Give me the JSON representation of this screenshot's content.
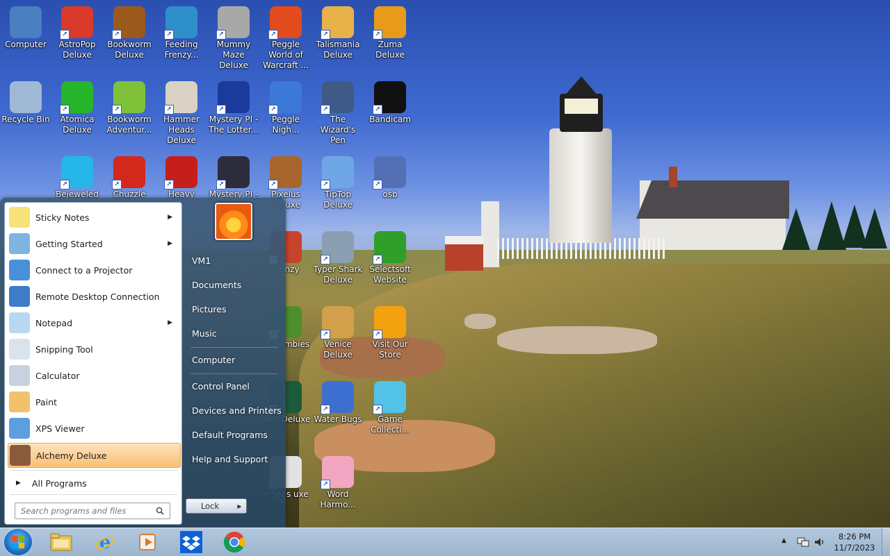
{
  "desktop": {
    "icons": [
      {
        "label": "Computer",
        "icon": "computer-icon",
        "color": "#4a7fc2"
      },
      {
        "label": "AstroPop Deluxe",
        "icon": "astropop-icon",
        "color": "#d93a2a"
      },
      {
        "label": "Bookworm Deluxe",
        "icon": "bookworm-icon",
        "color": "#9b5a1c"
      },
      {
        "label": "Feeding Frenzy...",
        "icon": "feeding-frenzy-icon",
        "color": "#2f8fc9"
      },
      {
        "label": "Mummy Maze Deluxe",
        "icon": "mummy-maze-icon",
        "color": "#a8a8a8"
      },
      {
        "label": "Peggle World of Warcraft ...",
        "icon": "peggle-wow-icon",
        "color": "#e24b1d"
      },
      {
        "label": "Talismania Deluxe",
        "icon": "talismania-icon",
        "color": "#e7b24a"
      },
      {
        "label": "Zuma Deluxe",
        "icon": "zuma-icon",
        "color": "#e89a1a"
      },
      {
        "label": "Recycle Bin",
        "icon": "recycle-bin-icon",
        "color": "#9fb8d4"
      },
      {
        "label": "Atomica Deluxe",
        "icon": "atomica-icon",
        "color": "#26b52a"
      },
      {
        "label": "Bookworm Adventur...",
        "icon": "bookworm-adventures-icon",
        "color": "#7fc23a"
      },
      {
        "label": "Hammer Heads Deluxe",
        "icon": "hammer-heads-icon",
        "color": "#d9d2c4"
      },
      {
        "label": "Mystery PI - The Lotter...",
        "icon": "mystery-pi-lottery-icon",
        "color": "#1a3a9c"
      },
      {
        "label": "Peggle Nigh...",
        "icon": "peggle-nights-icon",
        "color": "#3c78d8"
      },
      {
        "label": "The Wizard's Pen",
        "icon": "wizards-pen-icon",
        "color": "#3f5a87"
      },
      {
        "label": "Bandicam",
        "icon": "bandicam-icon",
        "color": "#111111"
      },
      {
        "label": "Bejeweled",
        "icon": "bejeweled-icon",
        "color": "#25b7e8"
      },
      {
        "label": "Chuzzle",
        "icon": "chuzzle-icon",
        "color": "#d3281c"
      },
      {
        "label": "Heavy",
        "icon": "heavy-weapon-icon",
        "color": "#c61d1d"
      },
      {
        "label": "Mystery PI -",
        "icon": "mystery-pi-icon",
        "color": "#2c2c3a"
      },
      {
        "label": "Pixelus Deluxe",
        "icon": "pixelus-icon",
        "color": "#a8662c"
      },
      {
        "label": "TipTop Deluxe",
        "icon": "tiptop-icon",
        "color": "#6fa7e6"
      },
      {
        "label": "osb",
        "icon": "osb-file-icon",
        "color": "#5470b5"
      },
      {
        "label": "Frenzy",
        "icon": "frenzy-icon",
        "color": "#c7432b"
      },
      {
        "label": "Typer Shark Deluxe",
        "icon": "typer-shark-icon",
        "color": "#8aa0b2"
      },
      {
        "label": "Selectsoft Website",
        "icon": "selectsoft-icon",
        "color": "#2f9f2a"
      },
      {
        "label": "ts vs mbies",
        "icon": "plants-vs-zombies-icon",
        "color": "#4e8f2a"
      },
      {
        "label": "Venice Deluxe",
        "icon": "venice-icon",
        "color": "#d2a04a"
      },
      {
        "label": "Visit Our Store",
        "icon": "visit-store-icon",
        "color": "#f2a10f"
      },
      {
        "label": "cket Deluxe",
        "icon": "rocket-icon",
        "color": "#1b5a3a"
      },
      {
        "label": "Water Bugs",
        "icon": "water-bugs-icon",
        "color": "#3d6fd1"
      },
      {
        "label": "Game Collecti...",
        "icon": "game-collection-icon",
        "color": "#52c3e6"
      },
      {
        "label": "n Seas uxe",
        "icon": "seas-icon",
        "color": "#e2e2e2"
      },
      {
        "label": "Word Harmo...",
        "icon": "word-harmony-icon",
        "color": "#f2a6c2"
      }
    ]
  },
  "start_menu": {
    "programs": [
      {
        "label": "Sticky Notes",
        "icon": "sticky-notes-icon",
        "submenu": true
      },
      {
        "label": "Getting Started",
        "icon": "getting-started-icon",
        "submenu": true
      },
      {
        "label": "Connect to a Projector",
        "icon": "projector-icon",
        "submenu": false
      },
      {
        "label": "Remote Desktop Connection",
        "icon": "remote-desktop-icon",
        "submenu": false
      },
      {
        "label": "Notepad",
        "icon": "notepad-icon",
        "submenu": true
      },
      {
        "label": "Snipping Tool",
        "icon": "snipping-tool-icon",
        "submenu": false
      },
      {
        "label": "Calculator",
        "icon": "calculator-icon",
        "submenu": false
      },
      {
        "label": "Paint",
        "icon": "paint-icon",
        "submenu": false
      },
      {
        "label": "XPS Viewer",
        "icon": "xps-viewer-icon",
        "submenu": false
      },
      {
        "label": "Alchemy Deluxe",
        "icon": "alchemy-icon",
        "submenu": false,
        "selected": true
      }
    ],
    "all_programs": "All Programs",
    "search_placeholder": "Search programs and files",
    "right_links": {
      "user": "VM1",
      "documents": "Documents",
      "pictures": "Pictures",
      "music": "Music",
      "computer": "Computer",
      "control_panel": "Control Panel",
      "devices": "Devices and Printers",
      "default_programs": "Default Programs",
      "help": "Help and Support"
    },
    "power_button": "Lock"
  },
  "taskbar": {
    "pinned": [
      {
        "icon": "file-explorer-icon"
      },
      {
        "icon": "internet-explorer-icon"
      },
      {
        "icon": "media-player-icon"
      },
      {
        "icon": "dropbox-icon"
      },
      {
        "icon": "chrome-icon"
      }
    ],
    "clock": {
      "time": "8:26 PM",
      "date": "11/7/2023"
    }
  },
  "colors": {
    "taskbar": "#a7bed6",
    "selected_item": "#f9bf73",
    "start_right_panel": "#3c5a78"
  }
}
